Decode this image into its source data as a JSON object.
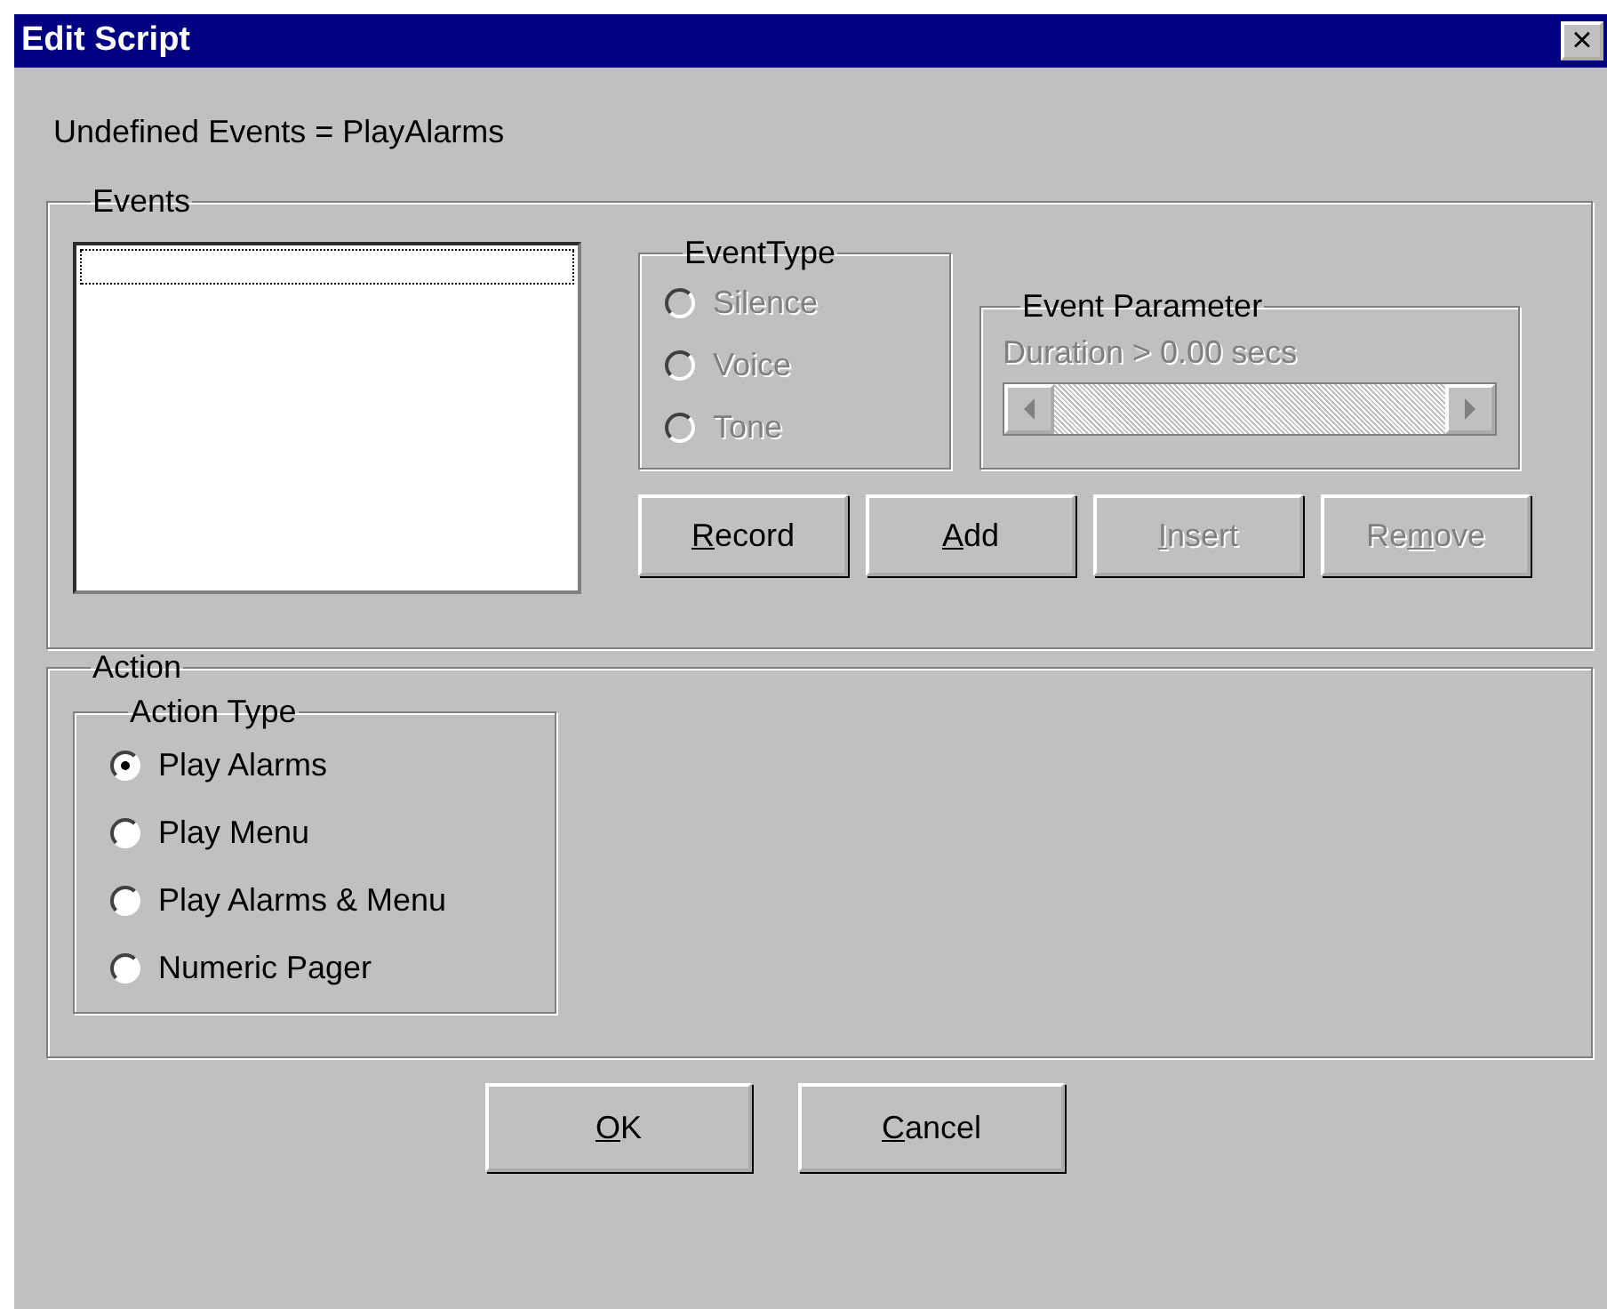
{
  "window": {
    "title": "Edit Script",
    "close": "×"
  },
  "undefined_events": "Undefined Events = PlayAlarms",
  "events": {
    "legend": "Events",
    "event_type": {
      "legend": "EventType",
      "options": [
        {
          "label": "Silence",
          "selected": false,
          "disabled": true
        },
        {
          "label": "Voice",
          "selected": false,
          "disabled": true
        },
        {
          "label": "Tone",
          "selected": false,
          "disabled": true
        }
      ]
    },
    "event_parameter": {
      "legend": "Event Parameter",
      "reading": "Duration > 0.00 secs",
      "disabled": true
    },
    "buttons": [
      {
        "key": "R",
        "after": "ecord",
        "disabled": false
      },
      {
        "key": "A",
        "after": "dd",
        "disabled": false
      },
      {
        "key": "I",
        "after": "nsert",
        "disabled": true
      },
      {
        "before": "Re",
        "key": "m",
        "after": "ove",
        "disabled": true
      }
    ]
  },
  "action": {
    "legend": "Action",
    "action_type": {
      "legend": "Action Type",
      "options": [
        {
          "label": "Play Alarms",
          "selected": true,
          "disabled": false
        },
        {
          "label": "Play Menu",
          "selected": false,
          "disabled": false
        },
        {
          "label": "Play Alarms & Menu",
          "selected": false,
          "disabled": false
        },
        {
          "label": "Numeric Pager",
          "selected": false,
          "disabled": false
        }
      ]
    }
  },
  "footer_buttons": [
    {
      "key": "O",
      "after": "K",
      "disabled": false
    },
    {
      "key": "C",
      "after": "ancel",
      "disabled": false
    }
  ]
}
